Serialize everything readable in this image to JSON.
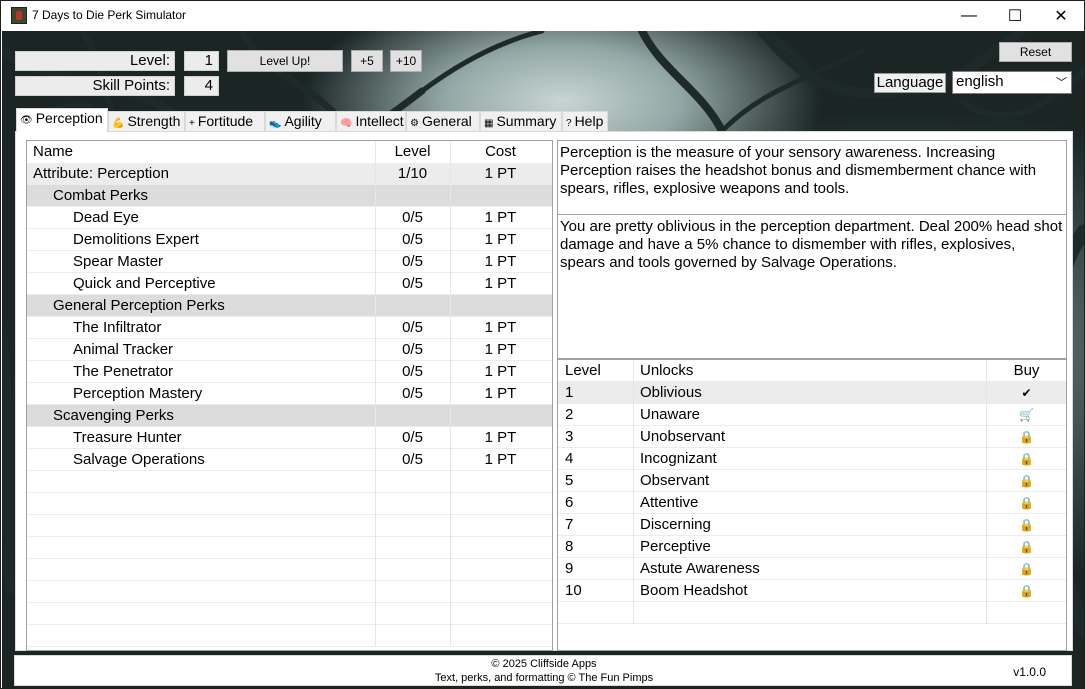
{
  "window": {
    "title": "7 Days to Die Perk Simulator",
    "controls": {
      "minimize": "—",
      "maximize": "☐",
      "close": "✕"
    }
  },
  "stats": {
    "level_label": "Level:",
    "level_value": "1",
    "skill_points_label": "Skill Points:",
    "skill_points_value": "4"
  },
  "buttons": {
    "level_up": "Level Up!",
    "plus5": "+5",
    "plus10": "+10",
    "reset": "Reset"
  },
  "language": {
    "label": "Language",
    "selected": "english"
  },
  "tabs": [
    {
      "label": "Perception",
      "icon": "eye-icon",
      "glyph": "👁"
    },
    {
      "label": "Strength",
      "icon": "arm-icon",
      "glyph": "💪"
    },
    {
      "label": "Fortitude",
      "icon": "plus-icon",
      "glyph": "+"
    },
    {
      "label": "Agility",
      "icon": "shoe-icon",
      "glyph": "👟"
    },
    {
      "label": "Intellect",
      "icon": "brain-icon",
      "glyph": "🧠"
    },
    {
      "label": "General",
      "icon": "gear-icon",
      "glyph": "⚙"
    },
    {
      "label": "Summary",
      "icon": "chart-icon",
      "glyph": "▦"
    },
    {
      "label": "Help",
      "icon": "help-icon",
      "glyph": "?"
    }
  ],
  "perk_table": {
    "headers": {
      "name": "Name",
      "level": "Level",
      "cost": "Cost"
    },
    "rows": [
      {
        "type": "attr",
        "name": "Attribute: Perception",
        "level": "1/10",
        "cost": "1 PT"
      },
      {
        "type": "cat",
        "name": "Combat Perks",
        "level": "",
        "cost": ""
      },
      {
        "type": "perk",
        "name": "Dead Eye",
        "level": "0/5",
        "cost": "1 PT"
      },
      {
        "type": "perk",
        "name": "Demolitions Expert",
        "level": "0/5",
        "cost": "1 PT"
      },
      {
        "type": "perk",
        "name": "Spear Master",
        "level": "0/5",
        "cost": "1 PT"
      },
      {
        "type": "perk",
        "name": "Quick and Perceptive",
        "level": "0/5",
        "cost": "1 PT"
      },
      {
        "type": "cat",
        "name": "General Perception Perks",
        "level": "",
        "cost": ""
      },
      {
        "type": "perk",
        "name": "The Infiltrator",
        "level": "0/5",
        "cost": "1 PT"
      },
      {
        "type": "perk",
        "name": "Animal Tracker",
        "level": "0/5",
        "cost": "1 PT"
      },
      {
        "type": "perk",
        "name": "The Penetrator",
        "level": "0/5",
        "cost": "1 PT"
      },
      {
        "type": "perk",
        "name": "Perception Mastery",
        "level": "0/5",
        "cost": "1 PT"
      },
      {
        "type": "cat",
        "name": "Scavenging Perks",
        "level": "",
        "cost": ""
      },
      {
        "type": "perk",
        "name": "Treasure Hunter",
        "level": "0/5",
        "cost": "1 PT"
      },
      {
        "type": "perk",
        "name": "Salvage Operations",
        "level": "0/5",
        "cost": "1 PT"
      }
    ],
    "empty_rows": 8
  },
  "description": {
    "attribute": "Perception is the measure of your sensory awareness. Increasing Perception raises the headshot bonus and dismemberment chance with spears, rifles, explosive weapons and tools.",
    "level": "You are pretty oblivious in the perception department. Deal 200% head shot damage and have a 5% chance to dismember with rifles, explosives, spears and tools governed by Salvage Operations."
  },
  "level_table": {
    "headers": {
      "level": "Level",
      "unlocks": "Unlocks",
      "buy": "Buy"
    },
    "rows": [
      {
        "level": "1",
        "unlock": "Oblivious",
        "status": "owned",
        "icon": "checkmark-icon",
        "glyph": "✔"
      },
      {
        "level": "2",
        "unlock": "Unaware",
        "status": "buyable",
        "icon": "cart-icon",
        "glyph": "🛒"
      },
      {
        "level": "3",
        "unlock": "Unobservant",
        "status": "locked",
        "icon": "lock-icon",
        "glyph": "🔒"
      },
      {
        "level": "4",
        "unlock": "Incognizant",
        "status": "locked",
        "icon": "lock-icon",
        "glyph": "🔒"
      },
      {
        "level": "5",
        "unlock": "Observant",
        "status": "locked",
        "icon": "lock-icon",
        "glyph": "🔒"
      },
      {
        "level": "6",
        "unlock": "Attentive",
        "status": "locked",
        "icon": "lock-icon",
        "glyph": "🔒"
      },
      {
        "level": "7",
        "unlock": "Discerning",
        "status": "locked",
        "icon": "lock-icon",
        "glyph": "🔒"
      },
      {
        "level": "8",
        "unlock": "Perceptive",
        "status": "locked",
        "icon": "lock-icon",
        "glyph": "🔒"
      },
      {
        "level": "9",
        "unlock": "Astute Awareness",
        "status": "locked",
        "icon": "lock-icon",
        "glyph": "🔒"
      },
      {
        "level": "10",
        "unlock": "Boom Headshot",
        "status": "locked",
        "icon": "lock-icon",
        "glyph": "🔒"
      }
    ]
  },
  "footer": {
    "copyright": "© 2025 Cliffside Apps",
    "credits": "Text, perks, and formatting © The Fun Pimps",
    "version": "v1.0.0"
  }
}
